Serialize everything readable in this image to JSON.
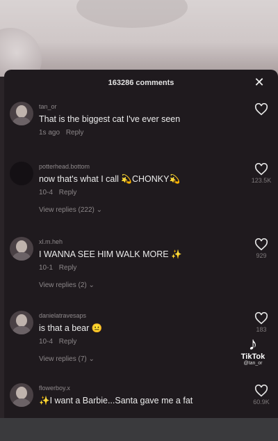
{
  "header": {
    "title": "163286 comments",
    "close_label": "✕"
  },
  "comments": [
    {
      "username": "tan_or",
      "text": "That is the biggest cat I've ever seen",
      "time": "1s ago",
      "reply": "Reply",
      "replies": "",
      "likes": ""
    },
    {
      "username": "potterhead.bottom",
      "text": "now that's what I call 💫CHONKY💫",
      "time": "10-4",
      "reply": "Reply",
      "replies": "View replies (222) ⌄",
      "likes": "123.5K"
    },
    {
      "username": "xl.m.heh",
      "text": "I WANNA SEE HIM WALK MORE ✨",
      "time": "10-1",
      "reply": "Reply",
      "replies": "View replies (2) ⌄",
      "likes": "929"
    },
    {
      "username": "danielatravesaps",
      "text": "is that a bear 😐",
      "time": "10-4",
      "reply": "Reply",
      "replies": "View replies (7) ⌄",
      "likes": "183"
    },
    {
      "username": "flowerboy.x",
      "text": "✨I want a Barbie...Santa gave me a fat",
      "time": "",
      "reply": "",
      "replies": "",
      "likes": "60.9K"
    }
  ],
  "watermark": {
    "logo": "♪",
    "name": "TikTok",
    "handle": "@tan_or"
  },
  "icons": {
    "heart": "heart-outline-icon",
    "close": "close-icon"
  }
}
